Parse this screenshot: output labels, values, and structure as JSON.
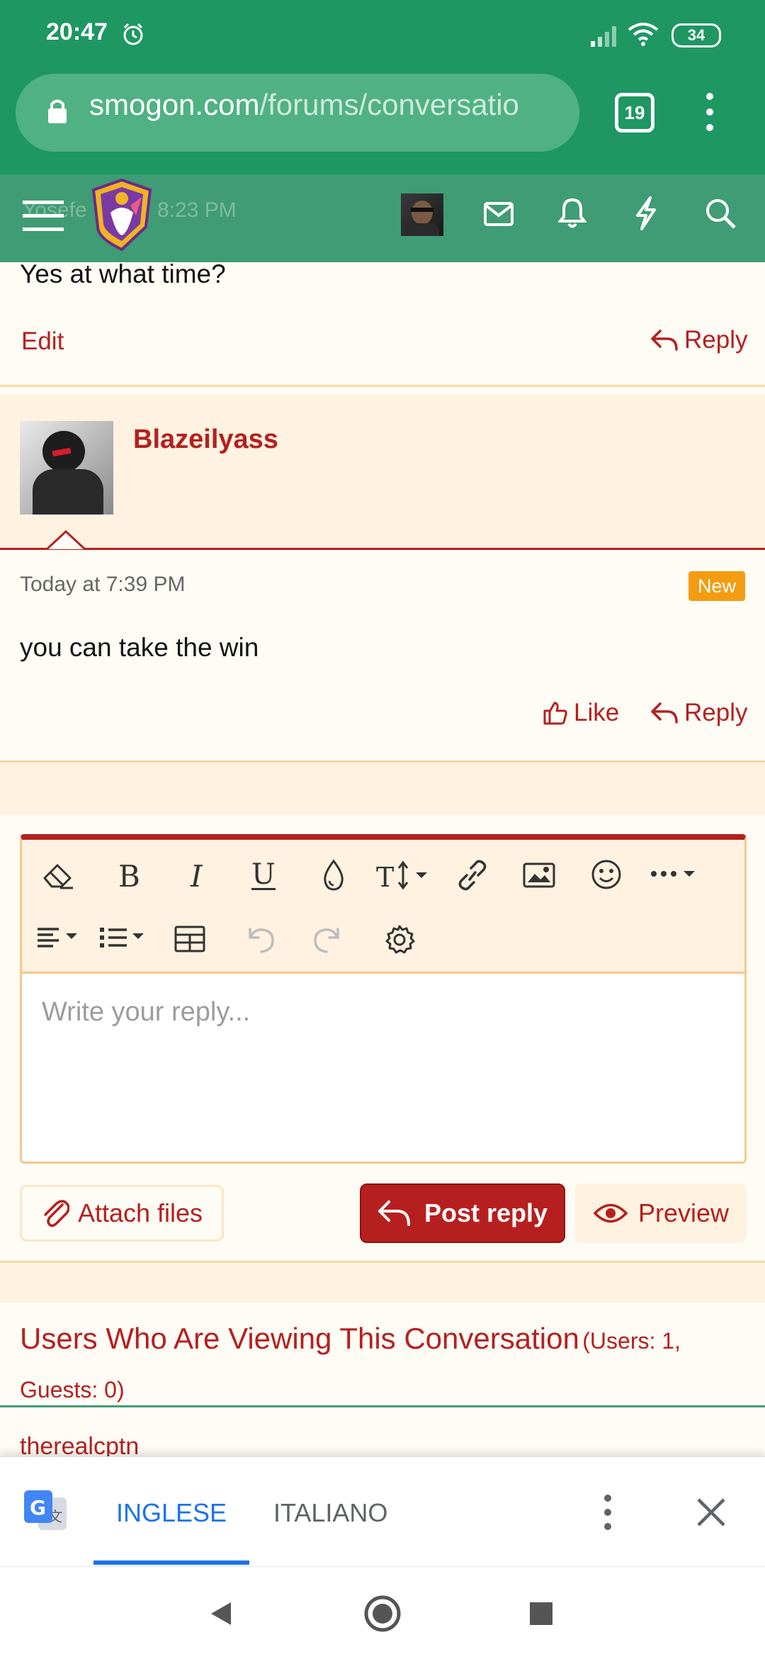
{
  "status": {
    "time": "20:47",
    "battery": "34"
  },
  "browser": {
    "url_domain": "smogon.com",
    "url_path": "/forums/conversatio",
    "tab_count": "19"
  },
  "previous_message": {
    "author_partial": "Yosefe",
    "time_partial": "8:23 PM",
    "text": "Yes at what time?",
    "edit_label": "Edit",
    "reply_label": "Reply"
  },
  "message": {
    "author": "Blazeilyass",
    "time": "Today at 7:39 PM",
    "badge": "New",
    "text": "you can take the win",
    "like_label": "Like",
    "reply_label": "Reply"
  },
  "editor": {
    "placeholder": "Write your reply...",
    "attach_label": "Attach files",
    "post_label": "Post reply",
    "preview_label": "Preview"
  },
  "viewers": {
    "title": "Users Who Are Viewing This Conversation",
    "counts": "(Users: 1, Guests: 0)",
    "user": "therealcptn"
  },
  "translate": {
    "tab_active": "INGLESE",
    "tab_other": "ITALIANO"
  },
  "colors": {
    "brand_green": "#1e9763",
    "accent_red": "#b5201f",
    "badge_orange": "#f39c12",
    "translate_blue": "#1a73e8"
  }
}
